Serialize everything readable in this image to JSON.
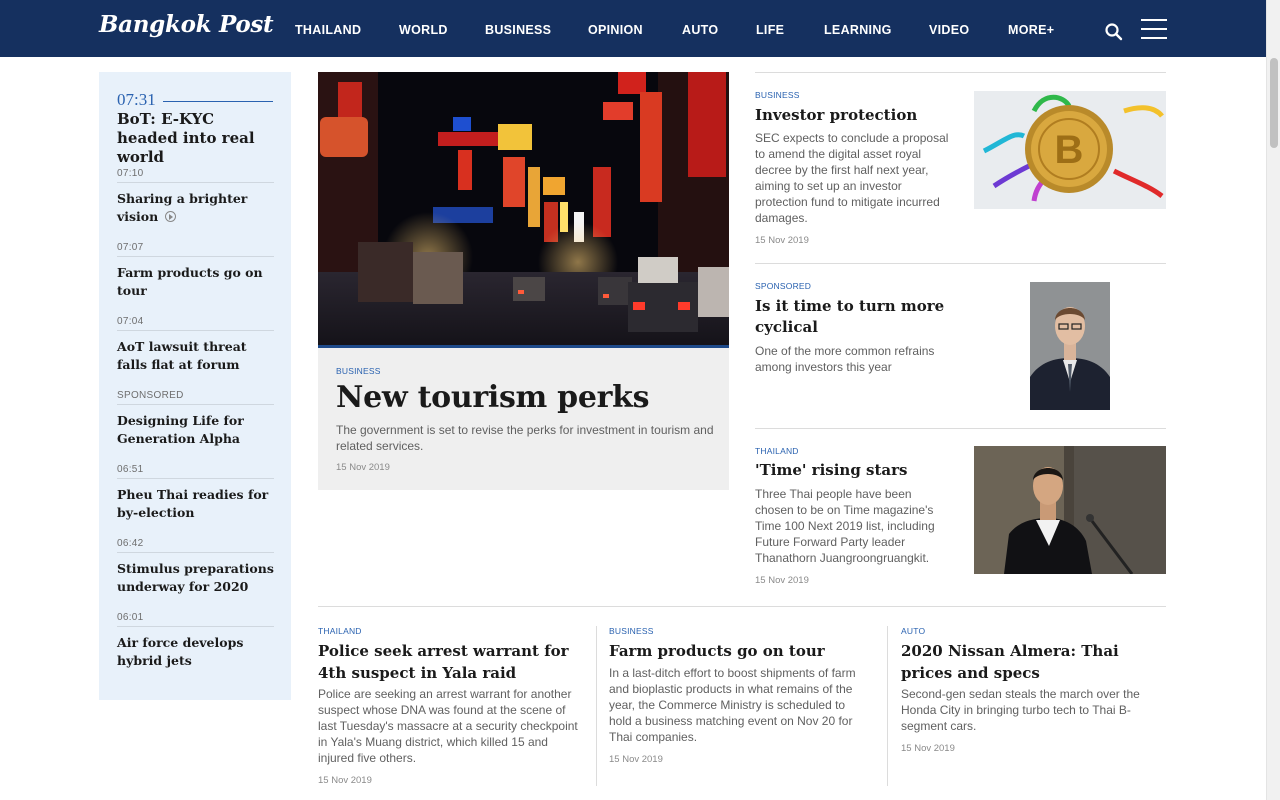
{
  "header": {
    "logo": "Bangkok Post",
    "nav": [
      "THAILAND",
      "WORLD",
      "BUSINESS",
      "OPINION",
      "AUTO",
      "LIFE",
      "LEARNING",
      "VIDEO",
      "MORE+"
    ]
  },
  "colors": {
    "header_bg": "#15305f",
    "accent": "#2a62b0",
    "sidebar_bg": "#e8f1fa",
    "hero_card_bg": "#efefef"
  },
  "sidebar": {
    "lead": {
      "time": "07:31",
      "title": "BoT: E-KYC headed into real world"
    },
    "items": [
      {
        "meta": "07:10",
        "title": "Sharing a brighter vision",
        "video": true
      },
      {
        "meta": "07:07",
        "title": "Farm products go on tour"
      },
      {
        "meta": "07:04",
        "title": "AoT lawsuit threat falls flat at forum"
      },
      {
        "meta": "SPONSORED",
        "title": "Designing Life for Generation Alpha"
      },
      {
        "meta": "06:51",
        "title": "Pheu Thai readies for by-election"
      },
      {
        "meta": "06:42",
        "title": "Stimulus preparations underway for 2020"
      },
      {
        "meta": "06:01",
        "title": "Air force develops hybrid jets"
      }
    ]
  },
  "hero": {
    "category": "BUSINESS",
    "title": "New tourism perks",
    "summary": "The government is set to revise the perks for investment in tourism and related services.",
    "date": "15 Nov 2019"
  },
  "right_stories": [
    {
      "category": "BUSINESS",
      "title": "Investor protection",
      "summary": "SEC expects to conclude a proposal to amend the digital asset royal decree by the first half next year, aiming to set up an investor protection fund to mitigate incurred damages.",
      "date": "15 Nov 2019"
    },
    {
      "category": "SPONSORED",
      "title": "Is it time to turn more cyclical",
      "summary": "One of the more common refrains among investors this year"
    },
    {
      "category": "THAILAND",
      "title": "'Time' rising stars",
      "summary": "Three Thai people have been chosen to be on Time magazine's Time 100 Next 2019 list, including Future Forward Party leader Thanathorn Juangroongruangkit.",
      "date": "15 Nov 2019"
    }
  ],
  "bottom_stories": [
    {
      "category": "THAILAND",
      "title": "Police seek arrest warrant for 4th suspect in Yala raid",
      "summary": "Police are seeking an arrest warrant for another suspect whose DNA was found at the scene of last Tuesday's massacre at a security checkpoint in Yala's Muang district, which killed 15 and injured five others.",
      "date": "15 Nov 2019"
    },
    {
      "category": "BUSINESS",
      "title": "Farm products go on tour",
      "summary": "In a last-ditch effort to boost shipments of farm and bioplastic products in what remains of the year, the Commerce Ministry is scheduled to hold a business matching event on Nov 20 for Thai companies.",
      "date": "15 Nov 2019"
    },
    {
      "category": "AUTO",
      "title": "2020 Nissan Almera: Thai prices and specs",
      "summary": "Second-gen sedan steals the march over the Honda City in bringing turbo tech to Thai B-segment cars.",
      "date": "15 Nov 2019"
    }
  ]
}
